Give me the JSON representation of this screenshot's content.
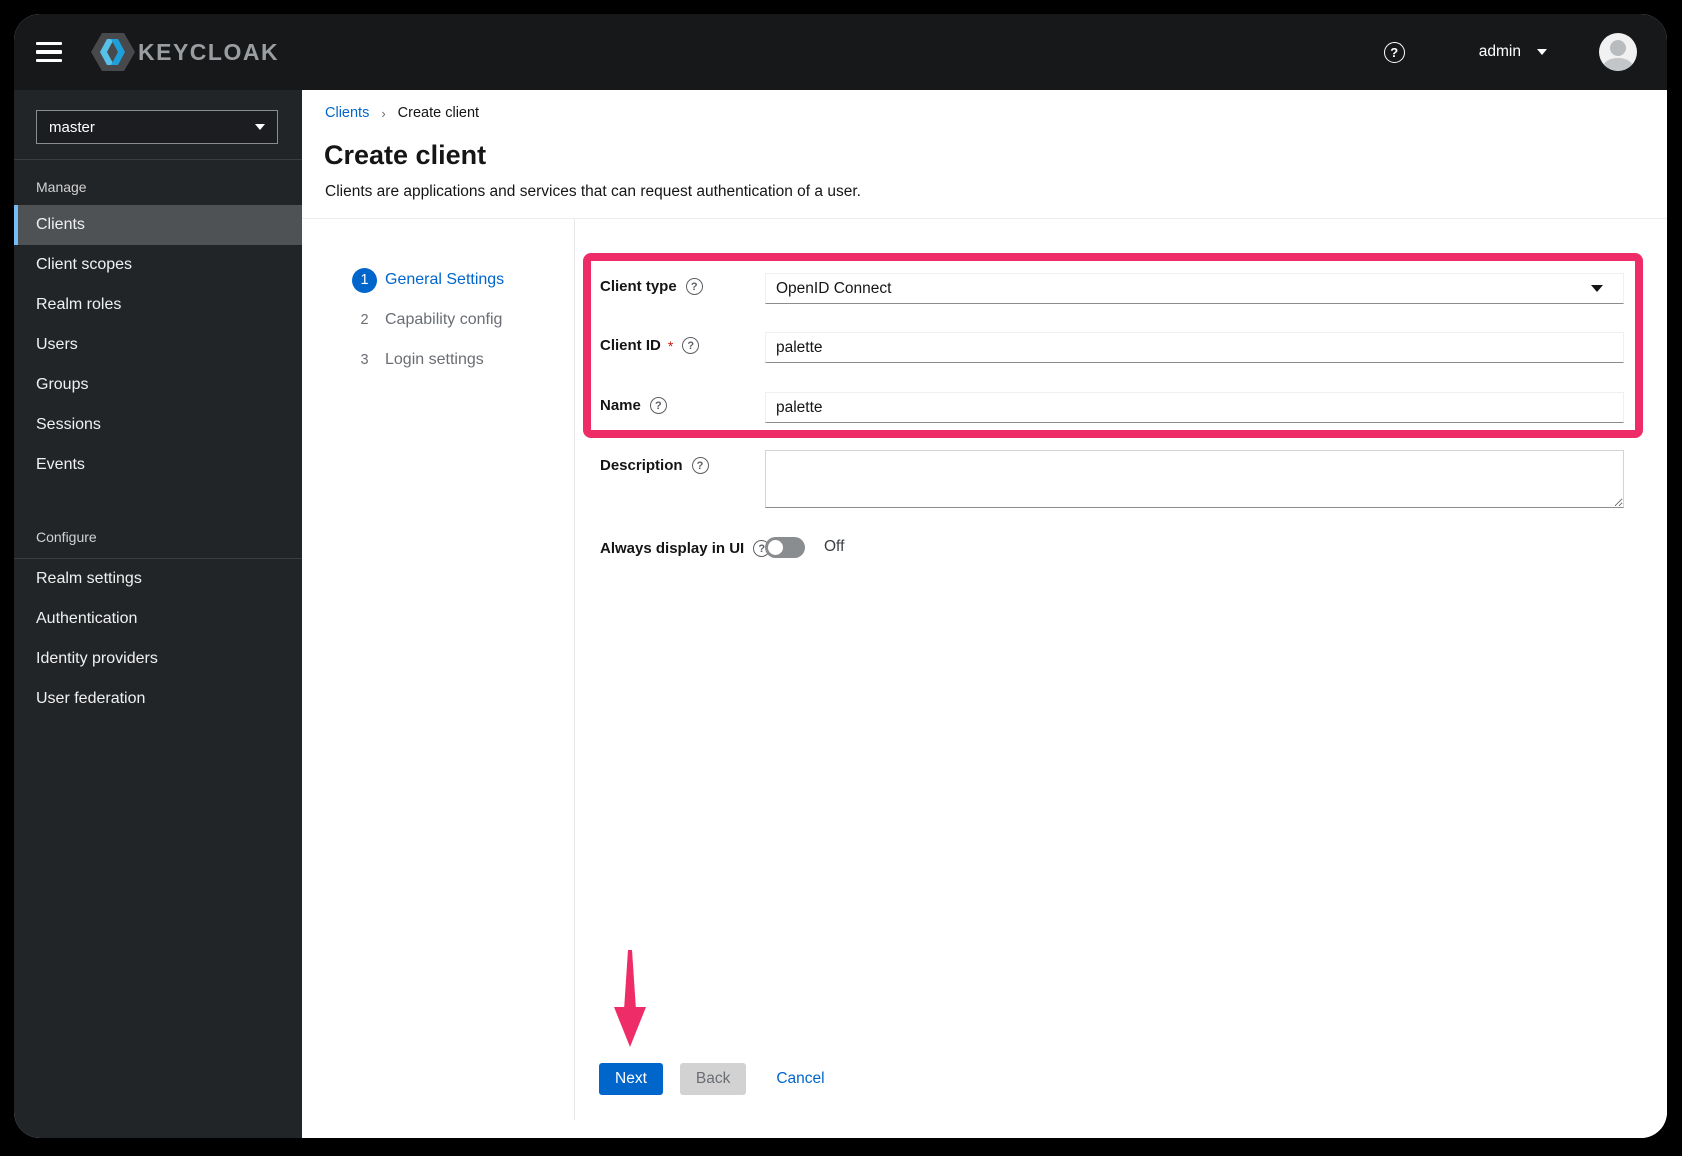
{
  "header": {
    "brand": "KEYCLOAK",
    "user": "admin"
  },
  "sidebar": {
    "realm": "master",
    "sections": [
      {
        "label": "Manage",
        "items": [
          {
            "label": "Clients"
          },
          {
            "label": "Client scopes"
          },
          {
            "label": "Realm roles"
          },
          {
            "label": "Users"
          },
          {
            "label": "Groups"
          },
          {
            "label": "Sessions"
          },
          {
            "label": "Events"
          }
        ]
      },
      {
        "label": "Configure",
        "items": [
          {
            "label": "Realm settings"
          },
          {
            "label": "Authentication"
          },
          {
            "label": "Identity providers"
          },
          {
            "label": "User federation"
          }
        ]
      }
    ]
  },
  "breadcrumb": {
    "link": "Clients",
    "current": "Create client"
  },
  "page": {
    "title": "Create client",
    "subtitle": "Clients are applications and services that can request authentication of a user."
  },
  "wizard": {
    "steps": [
      {
        "num": "1",
        "label": "General Settings"
      },
      {
        "num": "2",
        "label": "Capability config"
      },
      {
        "num": "3",
        "label": "Login settings"
      }
    ],
    "form": {
      "client_type": {
        "label": "Client type",
        "value": "OpenID Connect"
      },
      "client_id": {
        "label": "Client ID",
        "required": "*",
        "value": "palette"
      },
      "name": {
        "label": "Name",
        "value": "palette"
      },
      "description": {
        "label": "Description",
        "value": ""
      },
      "always_display": {
        "label": "Always display in UI",
        "state": "Off"
      }
    },
    "footer": {
      "next": "Next",
      "back": "Back",
      "cancel": "Cancel"
    }
  },
  "colors": {
    "highlight_pink": "#ee2d68",
    "primary_blue": "#0066cc",
    "active_nav_border": "#73bcf7",
    "masthead_bg": "#16181a",
    "sidebar_bg": "#222528"
  }
}
